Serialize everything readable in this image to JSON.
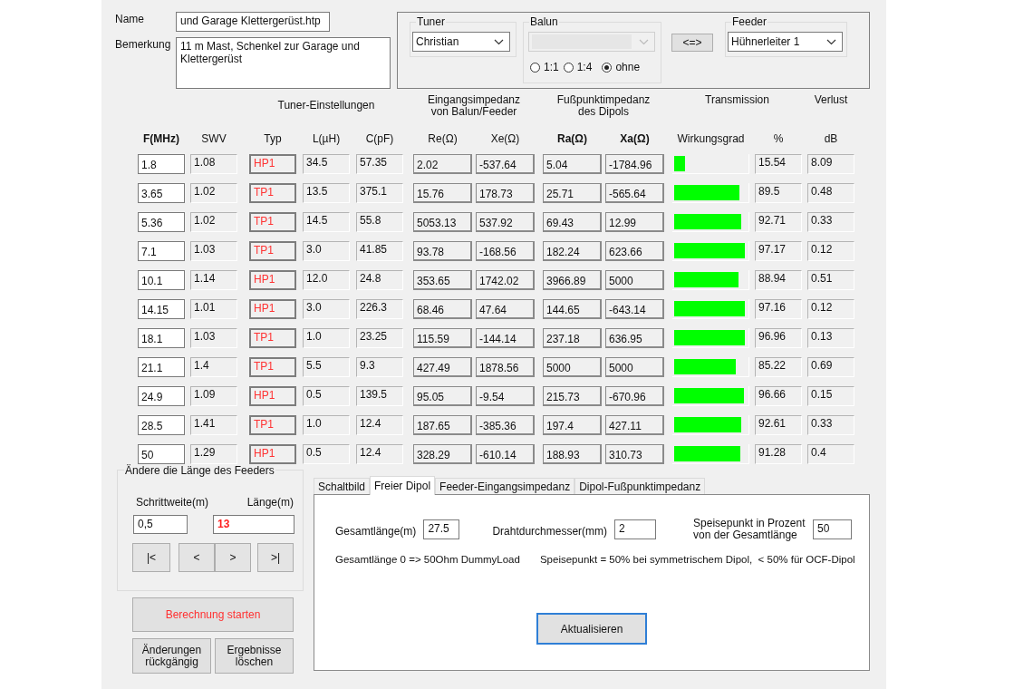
{
  "file": {
    "name_label": "Name",
    "name_value": "und Garage Klettergerüst.htp",
    "remark_label": "Bemerkung",
    "remark_value": "11 m Mast, Schenkel zur Garage und Klettergerüst"
  },
  "tuner": {
    "label": "Tuner",
    "value": "Christian"
  },
  "balun": {
    "label": "Balun",
    "disabled": true,
    "options": [
      {
        "label": "1:1",
        "selected": false
      },
      {
        "label": "1:4",
        "selected": false
      },
      {
        "label": "ohne",
        "selected": true
      }
    ]
  },
  "swap_button": "<=>",
  "feeder": {
    "label": "Feeder",
    "value": "Hühnerleiter 1"
  },
  "group_headers": [
    "Tuner-Einstellungen",
    "Eingangsimpedanz von Balun/Feeder",
    "Fußpunktimpedanz des Dipols",
    "Transmission",
    "Verlust"
  ],
  "columns": [
    {
      "label": "F(MHz)",
      "bold": true
    },
    {
      "label": "SWV",
      "bold": false
    },
    {
      "label": "Typ",
      "bold": false
    },
    {
      "label": "L(µH)",
      "bold": false
    },
    {
      "label": "C(pF)",
      "bold": false
    },
    {
      "label": "Re(Ω)",
      "bold": false
    },
    {
      "label": "Xe(Ω)",
      "bold": false
    },
    {
      "label": "Ra(Ω)",
      "bold": true
    },
    {
      "label": "Xa(Ω)",
      "bold": true
    },
    {
      "label": "Wirkungsgrad",
      "bold": false
    },
    {
      "label": "%",
      "bold": false
    },
    {
      "label": "dB",
      "bold": false
    }
  ],
  "rows": [
    {
      "f": "1.8",
      "swv": "1.08",
      "typ": "HP1",
      "l": "34.5",
      "c": "57.35",
      "re": "2.02",
      "xe": "-537.64",
      "ra": "5.04",
      "xa": "-1784.96",
      "level": 0.155,
      "percent": "15.54",
      "db": "8.09"
    },
    {
      "f": "3.65",
      "swv": "1.02",
      "typ": "TP1",
      "l": "13.5",
      "c": "375.1",
      "re": "15.76",
      "xe": "178.73",
      "ra": "25.71",
      "xa": "-565.64",
      "level": 0.895,
      "percent": "89.5",
      "db": "0.48"
    },
    {
      "f": "5.36",
      "swv": "1.02",
      "typ": "TP1",
      "l": "14.5",
      "c": "55.8",
      "re": "5053.13",
      "xe": "537.92",
      "ra": "69.43",
      "xa": "12.99",
      "level": 0.927,
      "percent": "92.71",
      "db": "0.33"
    },
    {
      "f": "7.1",
      "swv": "1.03",
      "typ": "TP1",
      "l": "3.0",
      "c": "41.85",
      "re": "93.78",
      "xe": "-168.56",
      "ra": "182.24",
      "xa": "623.66",
      "level": 0.972,
      "percent": "97.17",
      "db": "0.12"
    },
    {
      "f": "10.1",
      "swv": "1.14",
      "typ": "HP1",
      "l": "12.0",
      "c": "24.8",
      "re": "353.65",
      "xe": "1742.02",
      "ra": "3966.89",
      "xa": "5000",
      "level": 0.889,
      "percent": "88.94",
      "db": "0.51"
    },
    {
      "f": "14.15",
      "swv": "1.01",
      "typ": "HP1",
      "l": "3.0",
      "c": "226.3",
      "re": "68.46",
      "xe": "47.64",
      "ra": "144.65",
      "xa": "-643.14",
      "level": 0.972,
      "percent": "97.16",
      "db": "0.12"
    },
    {
      "f": "18.1",
      "swv": "1.03",
      "typ": "TP1",
      "l": "1.0",
      "c": "23.25",
      "re": "115.59",
      "xe": "-144.14",
      "ra": "237.18",
      "xa": "636.95",
      "level": 0.97,
      "percent": "96.96",
      "db": "0.13"
    },
    {
      "f": "21.1",
      "swv": "1.4",
      "typ": "TP1",
      "l": "5.5",
      "c": "9.3",
      "re": "427.49",
      "xe": "1878.56",
      "ra": "5000",
      "xa": "5000",
      "level": 0.852,
      "percent": "85.22",
      "db": "0.69"
    },
    {
      "f": "24.9",
      "swv": "1.09",
      "typ": "HP1",
      "l": "0.5",
      "c": "139.5",
      "re": "95.05",
      "xe": "-9.54",
      "ra": "215.73",
      "xa": "-670.96",
      "level": 0.967,
      "percent": "96.66",
      "db": "0.15"
    },
    {
      "f": "28.5",
      "swv": "1.41",
      "typ": "TP1",
      "l": "1.0",
      "c": "12.4",
      "re": "187.65",
      "xe": "-385.36",
      "ra": "197.4",
      "xa": "427.11",
      "level": 0.926,
      "percent": "92.61",
      "db": "0.33"
    },
    {
      "f": "50",
      "swv": "1.29",
      "typ": "HP1",
      "l": "0.5",
      "c": "12.4",
      "re": "328.29",
      "xe": "-610.14",
      "ra": "188.93",
      "xa": "310.73",
      "level": 0.913,
      "percent": "91.28",
      "db": "0.4"
    }
  ],
  "feeder_length": {
    "title": "Ändere die Länge des Feeders",
    "step_label": "Schrittweite(m)",
    "step_value": "0,5",
    "length_label": "Länge(m)",
    "length_value": "13",
    "buttons": [
      "|<",
      "<",
      ">",
      ">|"
    ]
  },
  "start_button": "Berechnung starten",
  "undo_button": "Änderungen rückgängig",
  "clear_button": "Ergebnisse löschen",
  "tabs": [
    {
      "label": "Schaltbild",
      "selected": false
    },
    {
      "label": "Freier Dipol",
      "selected": true
    },
    {
      "label": "Feeder-Eingangsimpedanz",
      "selected": false
    },
    {
      "label": "Dipol-Fußpunktimpedanz",
      "selected": false
    }
  ],
  "dipol": {
    "length_label": "Gesamtlänge(m)",
    "length_value": "27.5",
    "wire_label": "Drahtdurchmesser(mm)",
    "wire_value": "2",
    "feed_label": "Speisepunkt in Prozent von der Gesamtlänge",
    "feed_value": "50",
    "note_dummy": "Gesamtlänge 0 => 50Ohm DummyLoad",
    "note_feed": "Speisepunkt = 50% bei symmetrischem Dipol,  < 50% für OCF-Dipol",
    "update_button": "Aktualisieren"
  }
}
